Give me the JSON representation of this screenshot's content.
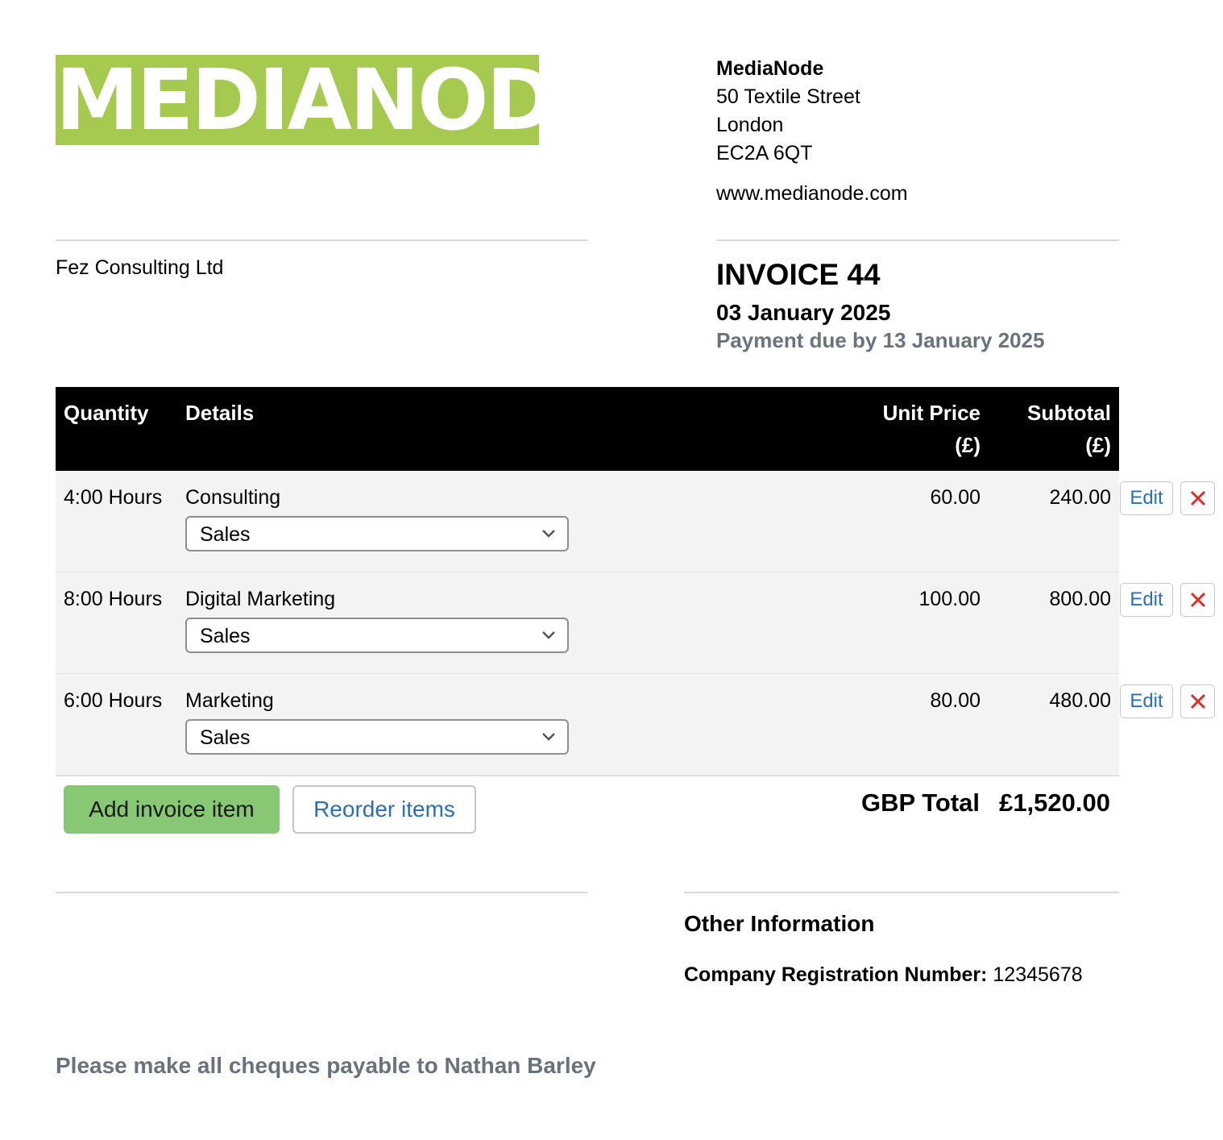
{
  "logo": {
    "text": "MEDIANODE",
    "color": "#a6c94f"
  },
  "company": {
    "name": "MediaNode",
    "address": [
      "50 Textile Street",
      "London",
      "EC2A 6QT"
    ],
    "website": "www.medianode.com"
  },
  "client": {
    "name": "Fez Consulting Ltd"
  },
  "invoice": {
    "title": "INVOICE 44",
    "date": "03 January 2025",
    "due": "Payment due by 13 January 2025"
  },
  "table": {
    "headers": {
      "quantity": "Quantity",
      "details": "Details",
      "unit_price_line1": "Unit Price",
      "unit_price_line2": "(£)",
      "subtotal_line1": "Subtotal",
      "subtotal_line2": "(£)"
    },
    "rows": [
      {
        "quantity": "4:00 Hours",
        "details": "Consulting",
        "category": "Sales",
        "unit_price": "60.00",
        "subtotal": "240.00"
      },
      {
        "quantity": "8:00 Hours",
        "details": "Digital Marketing",
        "category": "Sales",
        "unit_price": "100.00",
        "subtotal": "800.00"
      },
      {
        "quantity": "6:00 Hours",
        "details": "Marketing",
        "category": "Sales",
        "unit_price": "80.00",
        "subtotal": "480.00"
      }
    ],
    "edit_label": "Edit"
  },
  "actions": {
    "add_label": "Add invoice item",
    "reorder_label": "Reorder items"
  },
  "total": {
    "label": "GBP Total",
    "value": "£1,520.00"
  },
  "other": {
    "heading": "Other Information",
    "reg_label": "Company Registration Number:",
    "reg_value": "12345678"
  },
  "footer": {
    "cheque_note": "Please make all cheques payable to Nathan Barley"
  },
  "colors": {
    "accent_green": "#88c774",
    "link_blue": "#2c6fb7",
    "delete_red": "#d9302c",
    "muted_gray": "#6a737b"
  }
}
